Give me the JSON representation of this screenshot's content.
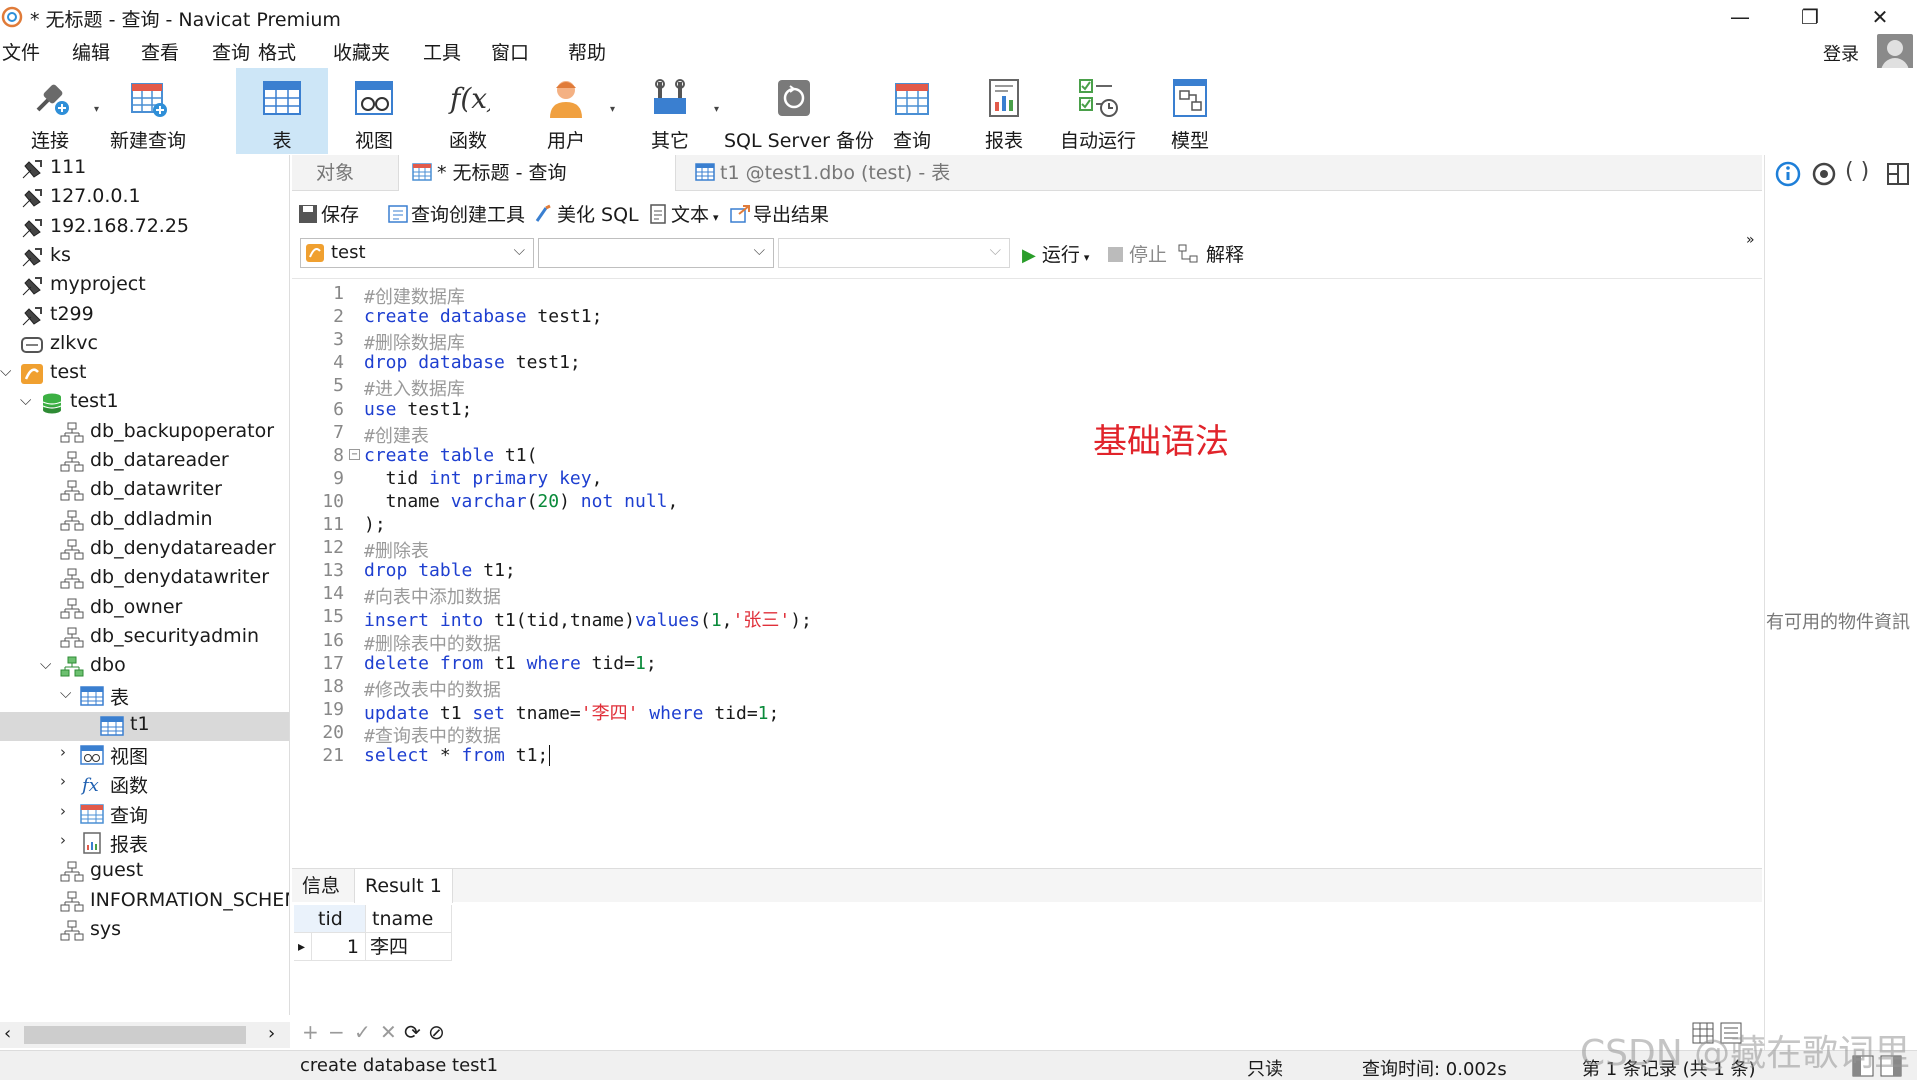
{
  "window": {
    "title": "* 无标题 - 查询 - Navicat Premium",
    "minimize": "—",
    "maximize": "❐",
    "close": "✕"
  },
  "menu": [
    "文件",
    "编辑",
    "查看",
    "查询",
    "格式",
    "收藏夹",
    "工具",
    "窗口",
    "帮助"
  ],
  "account": {
    "login_label": "登录"
  },
  "ribbon": [
    {
      "label": "连接",
      "icon": "plug-icon"
    },
    {
      "label": "新建查询",
      "icon": "new-query-icon"
    },
    {
      "label": "表",
      "icon": "table-icon",
      "active": true
    },
    {
      "label": "视图",
      "icon": "view-icon"
    },
    {
      "label": "函数",
      "icon": "function-icon"
    },
    {
      "label": "用户",
      "icon": "user-icon"
    },
    {
      "label": "其它",
      "icon": "tools-icon"
    },
    {
      "label": "SQL Server 备份",
      "icon": "backup-icon"
    },
    {
      "label": "查询",
      "icon": "query-icon"
    },
    {
      "label": "报表",
      "icon": "report-icon"
    },
    {
      "label": "自动运行",
      "icon": "automation-icon"
    },
    {
      "label": "模型",
      "icon": "model-icon"
    }
  ],
  "tree": [
    {
      "label": "111",
      "icon": "connection-icon",
      "arrow": ""
    },
    {
      "label": "127.0.0.1",
      "icon": "connection-icon",
      "arrow": ""
    },
    {
      "label": "192.168.72.25",
      "icon": "connection-icon",
      "arrow": ""
    },
    {
      "label": "ks",
      "icon": "connection-icon",
      "arrow": ""
    },
    {
      "label": "myproject",
      "icon": "connection-icon",
      "arrow": ""
    },
    {
      "label": "t299",
      "icon": "connection-icon",
      "arrow": ""
    },
    {
      "label": "zlkvc",
      "icon": "server-icon",
      "arrow": ""
    },
    {
      "label": "test",
      "icon": "sqlserver-connection-icon",
      "arrow": "⌵"
    },
    {
      "label": "test1",
      "icon": "database-icon",
      "arrow": "⌵"
    },
    {
      "label": "db_backupoperator",
      "icon": "schema-icon",
      "arrow": ""
    },
    {
      "label": "db_datareader",
      "icon": "schema-icon",
      "arrow": ""
    },
    {
      "label": "db_datawriter",
      "icon": "schema-icon",
      "arrow": ""
    },
    {
      "label": "db_ddladmin",
      "icon": "schema-icon",
      "arrow": ""
    },
    {
      "label": "db_denydatareader",
      "icon": "schema-icon",
      "arrow": ""
    },
    {
      "label": "db_denydatawriter",
      "icon": "schema-icon",
      "arrow": ""
    },
    {
      "label": "db_owner",
      "icon": "schema-icon",
      "arrow": ""
    },
    {
      "label": "db_securityadmin",
      "icon": "schema-icon",
      "arrow": ""
    },
    {
      "label": "dbo",
      "icon": "schema-green-icon",
      "arrow": "⌵"
    },
    {
      "label": "表",
      "icon": "table-icon",
      "arrow": "⌵"
    },
    {
      "label": "t1",
      "icon": "table-icon",
      "arrow": "",
      "selected": true
    },
    {
      "label": "视图",
      "icon": "view-icon",
      "arrow": "›"
    },
    {
      "label": "函数",
      "icon": "function-icon",
      "arrow": "›"
    },
    {
      "label": "查询",
      "icon": "query-icon",
      "arrow": "›"
    },
    {
      "label": "报表",
      "icon": "report-icon",
      "arrow": "›"
    },
    {
      "label": "guest",
      "icon": "schema-icon",
      "arrow": ""
    },
    {
      "label": "INFORMATION_SCHEMA",
      "icon": "schema-icon",
      "arrow": ""
    },
    {
      "label": "sys",
      "icon": "schema-icon",
      "arrow": ""
    }
  ],
  "tabs": {
    "objects": "对象",
    "query": "* 无标题 - 查询",
    "table": "t1 @test1.dbo (test) - 表"
  },
  "query_toolbar": {
    "save": "保存",
    "builder": "查询创建工具",
    "beautify": "美化 SQL",
    "text": "文本",
    "export": "导出结果"
  },
  "selectors": {
    "connection": "test",
    "database": "",
    "schema": ""
  },
  "run_bar": {
    "run": "运行",
    "stop": "停止",
    "explain": "解释"
  },
  "code": [
    {
      "n": "1",
      "parts": [
        [
          "cm",
          "#创建数据库"
        ]
      ]
    },
    {
      "n": "2",
      "parts": [
        [
          "kw",
          "create"
        ],
        [
          "",
          " "
        ],
        [
          "kw",
          "database"
        ],
        [
          "",
          " test1;"
        ]
      ]
    },
    {
      "n": "3",
      "parts": [
        [
          "cm",
          "#删除数据库"
        ]
      ]
    },
    {
      "n": "4",
      "parts": [
        [
          "kw",
          "drop"
        ],
        [
          "",
          " "
        ],
        [
          "kw",
          "database"
        ],
        [
          "",
          " test1;"
        ]
      ]
    },
    {
      "n": "5",
      "parts": [
        [
          "cm",
          "#进入数据库"
        ]
      ]
    },
    {
      "n": "6",
      "parts": [
        [
          "kw",
          "use"
        ],
        [
          "",
          " test1;"
        ]
      ]
    },
    {
      "n": "7",
      "parts": [
        [
          "cm",
          "#创建表"
        ]
      ]
    },
    {
      "n": "8",
      "parts": [
        [
          "kw",
          "create"
        ],
        [
          "",
          " "
        ],
        [
          "kw",
          "table"
        ],
        [
          "",
          " t1("
        ]
      ],
      "fold": true
    },
    {
      "n": "9",
      "parts": [
        [
          "",
          "  tid "
        ],
        [
          "kw",
          "int"
        ],
        [
          "",
          " "
        ],
        [
          "kw",
          "primary"
        ],
        [
          "",
          " "
        ],
        [
          "kw",
          "key"
        ],
        [
          "",
          ","
        ]
      ]
    },
    {
      "n": "10",
      "parts": [
        [
          "",
          "  tname "
        ],
        [
          "kw",
          "varchar"
        ],
        [
          "",
          "("
        ],
        [
          "num",
          "20"
        ],
        [
          "",
          ") "
        ],
        [
          "kw",
          "not"
        ],
        [
          "",
          " "
        ],
        [
          "kw",
          "null"
        ],
        [
          "",
          ","
        ]
      ]
    },
    {
      "n": "11",
      "parts": [
        [
          "",
          ");"
        ]
      ]
    },
    {
      "n": "12",
      "parts": [
        [
          "cm",
          "#删除表"
        ]
      ]
    },
    {
      "n": "13",
      "parts": [
        [
          "kw",
          "drop"
        ],
        [
          "",
          " "
        ],
        [
          "kw",
          "table"
        ],
        [
          "",
          " t1;"
        ]
      ]
    },
    {
      "n": "14",
      "parts": [
        [
          "cm",
          "#向表中添加数据"
        ]
      ]
    },
    {
      "n": "15",
      "parts": [
        [
          "kw",
          "insert"
        ],
        [
          "",
          " "
        ],
        [
          "kw",
          "into"
        ],
        [
          "",
          " t1(tid,tname)"
        ],
        [
          "kw",
          "values"
        ],
        [
          "",
          "("
        ],
        [
          "num",
          "1"
        ],
        [
          "",
          ","
        ],
        [
          "str",
          "'张三'"
        ],
        [
          "",
          ");"
        ]
      ]
    },
    {
      "n": "16",
      "parts": [
        [
          "cm",
          "#删除表中的数据"
        ]
      ]
    },
    {
      "n": "17",
      "parts": [
        [
          "kw",
          "delete"
        ],
        [
          "",
          " "
        ],
        [
          "kw",
          "from"
        ],
        [
          "",
          " t1 "
        ],
        [
          "kw",
          "where"
        ],
        [
          "",
          " tid="
        ],
        [
          "num",
          "1"
        ],
        [
          "",
          ";"
        ]
      ]
    },
    {
      "n": "18",
      "parts": [
        [
          "cm",
          "#修改表中的数据"
        ]
      ]
    },
    {
      "n": "19",
      "parts": [
        [
          "kw",
          "update"
        ],
        [
          "",
          " t1 "
        ],
        [
          "kw",
          "set"
        ],
        [
          "",
          " tname="
        ],
        [
          "str",
          "'李四'"
        ],
        [
          "",
          " "
        ],
        [
          "kw",
          "where"
        ],
        [
          "",
          " tid="
        ],
        [
          "num",
          "1"
        ],
        [
          "",
          ";"
        ]
      ]
    },
    {
      "n": "20",
      "parts": [
        [
          "cm",
          "#查询表中的数据"
        ]
      ]
    },
    {
      "n": "21",
      "parts": [
        [
          "kw",
          "select"
        ],
        [
          "",
          " * "
        ],
        [
          "kw",
          "from"
        ],
        [
          "",
          " t1;"
        ]
      ]
    }
  ],
  "annotation": "基础语法",
  "result_tabs": [
    "信息",
    "Result 1"
  ],
  "result_grid": {
    "columns": [
      "tid",
      "tname"
    ],
    "rows": [
      [
        "1",
        "李四"
      ]
    ],
    "row_marker": "▸"
  },
  "grid_toolbar": [
    "+",
    "−",
    "✓",
    "✕",
    "⟳",
    "⊘"
  ],
  "status": {
    "sql": "create database test1",
    "mode": "只读",
    "time": "查询时间: 0.002s",
    "records": "第 1 条记录 (共 1 条)"
  },
  "right_panel": {
    "text": "有可用的物件資訊"
  },
  "watermark": "CSDN @藏在歌词里",
  "colors": {
    "keyword": "#1e3fd0",
    "comment": "#9a9a9a",
    "number": "#0a8a3a",
    "string": "#e0303a",
    "annotation": "#e1242b",
    "active_ribbon": "#cde6f7"
  }
}
